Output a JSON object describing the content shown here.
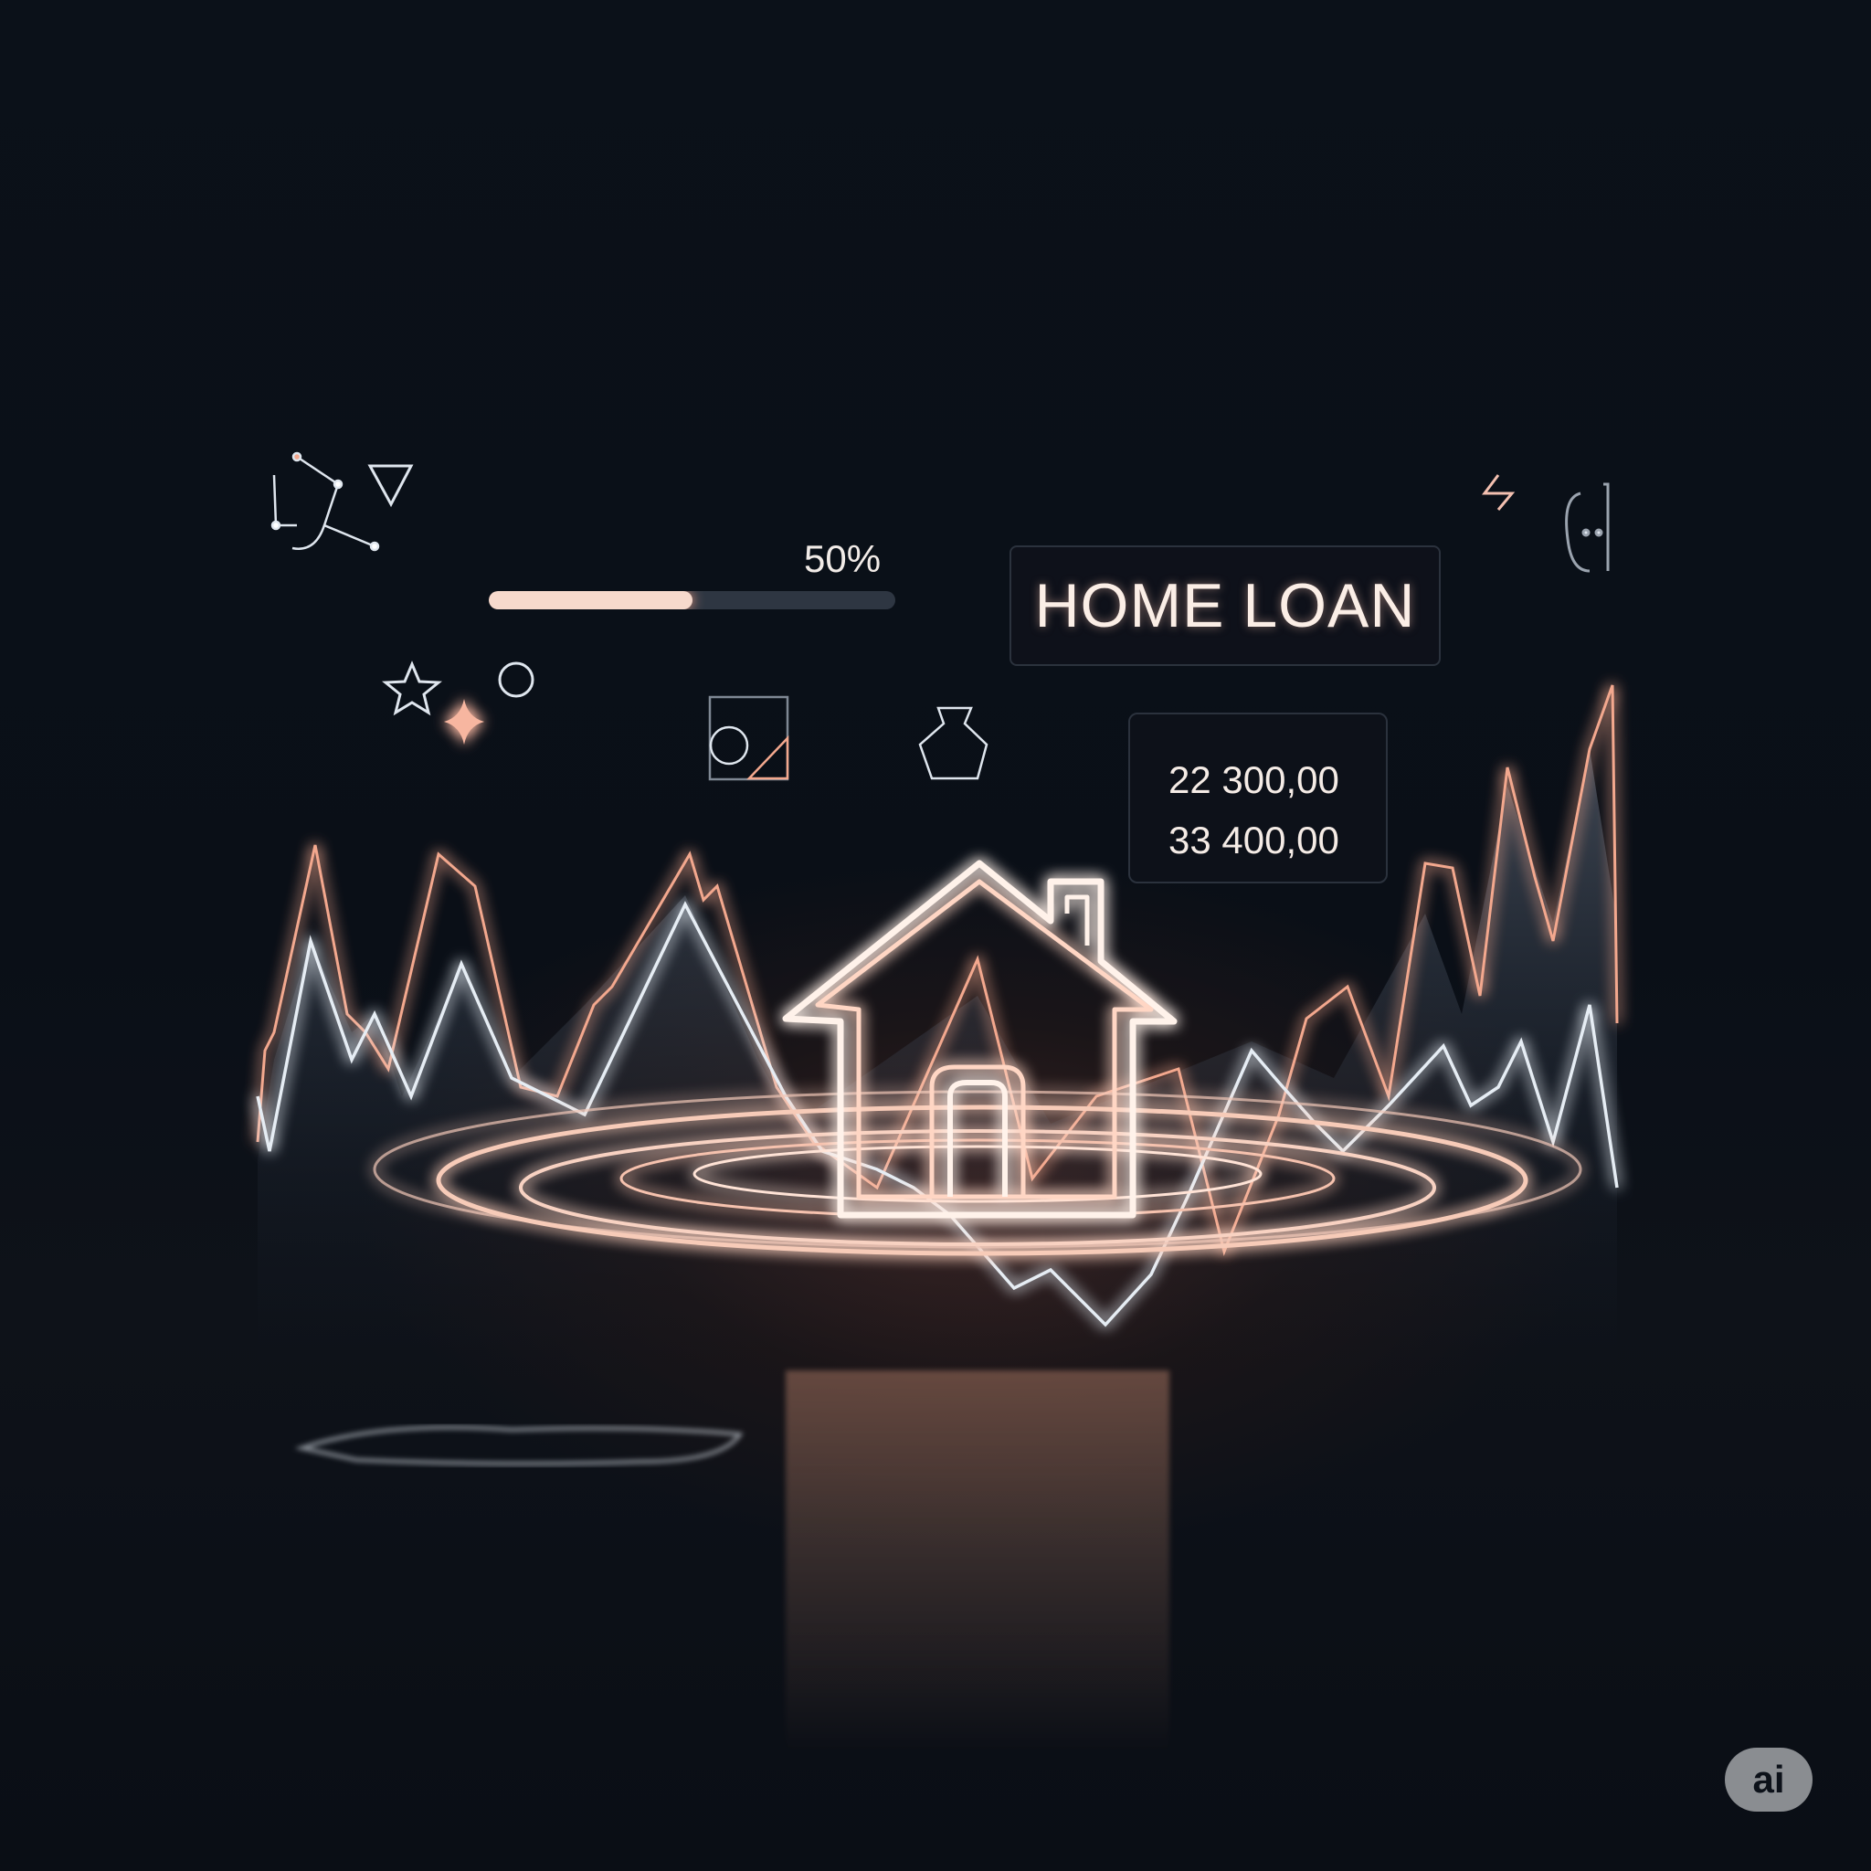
{
  "progress": {
    "label": "50%",
    "value": 50
  },
  "card": {
    "title": "HOME LOAN"
  },
  "values": {
    "first": "22 300,00",
    "second": "33 400,00"
  },
  "badge": {
    "label": "ai"
  },
  "colors": {
    "accent": "#f3a88e",
    "line": "#dfe6ee",
    "background": "#0a0f17"
  }
}
